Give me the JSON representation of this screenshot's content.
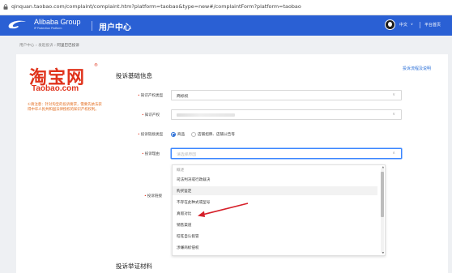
{
  "browser": {
    "url": "qinquan.taobao.com/complaint/complaint.htm?platform=taobao&type=new#/complaintForm?platform=taobao"
  },
  "header": {
    "brand_name": "Alibaba Group",
    "brand_sub": "IP Protection Platform",
    "title": "用户中心",
    "lang_label": "中文",
    "home_link": "平台首页"
  },
  "breadcrumb": {
    "items": [
      "用户中心",
      "发起投诉",
      "阿里巴巴投诉"
    ]
  },
  "sidebar": {
    "logo_cn": "淘宝网",
    "logo_reg": "®",
    "logo_en": "Taobao.com",
    "notice": "①请注意：针对淘宝的投诉要求，需要先依法获得中华人民共和国法律授权的知识产权权利。"
  },
  "form": {
    "section_title": "投诉基础信息",
    "help_link": "投诉流程及说明",
    "ip_type": {
      "label": "知识产权类型",
      "value": "商标权"
    },
    "ip_right": {
      "label": "知识产权"
    },
    "link_type": {
      "label": "投诉链接类型",
      "options": [
        "商品",
        "店铺招牌、店铺公告等"
      ],
      "selected": "商品"
    },
    "reason": {
      "label": "投诉理由",
      "placeholder": "请选择原因"
    },
    "link_label": "投诉链接",
    "section2_title": "投诉举证材料"
  },
  "dropdown": {
    "items": [
      {
        "text": "概述",
        "group": true
      },
      {
        "text": "司法判决或行政裁决",
        "group": false
      },
      {
        "text": "购买鉴定",
        "group": false
      },
      {
        "text": "不存在此种式或型号",
        "group": false
      },
      {
        "text": "真假对比",
        "group": false
      },
      {
        "text": "销售渠道",
        "group": false
      },
      {
        "text": "旺旺自认假冒",
        "group": false
      },
      {
        "text": "涉嫌商标侵权",
        "group": false
      }
    ],
    "highlighted_index": 2
  },
  "colors": {
    "header_blue": "#2a60d4",
    "taobao_orange": "#e0331c",
    "accent_blue": "#2a6fd8",
    "annotation_red": "#d6202a"
  }
}
